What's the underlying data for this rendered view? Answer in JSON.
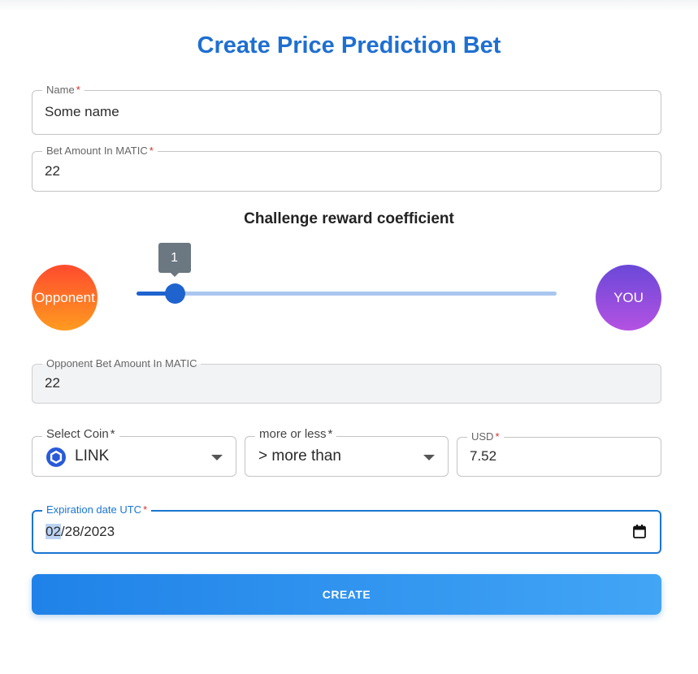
{
  "page": {
    "title": "Create Price Prediction Bet"
  },
  "form": {
    "name": {
      "label": "Name",
      "required_mark": "*",
      "value": "Some name"
    },
    "bet_amount": {
      "label": "Bet Amount In MATIC",
      "required_mark": "*",
      "value": "22"
    },
    "coefficient": {
      "heading": "Challenge reward coefficient",
      "opponent_label": "Opponent",
      "you_label": "YOU",
      "value": "1",
      "fill_fraction": 0.09
    },
    "opponent_bet": {
      "label": "Opponent Bet Amount In MATIC",
      "value": "22"
    },
    "coin": {
      "label": "Select Coin",
      "required_mark": "*",
      "value": "LINK",
      "icon": "chainlink-icon"
    },
    "direction": {
      "label": "more or less",
      "required_mark": "*",
      "value": "> more than"
    },
    "usd": {
      "label": "USD",
      "required_mark": "*",
      "value": "7.52"
    },
    "expiration": {
      "label": "Expiration date UTC",
      "required_mark": "*",
      "month": "02",
      "rest": "/28/2023",
      "icon": "calendar-icon"
    },
    "submit": {
      "label": "CREATE"
    }
  },
  "colors": {
    "accent": "#1f6fd1",
    "required": "#d32f2f",
    "opponent_gradient": [
      "#ff4a2e",
      "#ff9b1f"
    ],
    "you_gradient": [
      "#6a48d8",
      "#b452e2"
    ],
    "button_gradient": [
      "#1f82e8",
      "#42a5f5"
    ]
  }
}
